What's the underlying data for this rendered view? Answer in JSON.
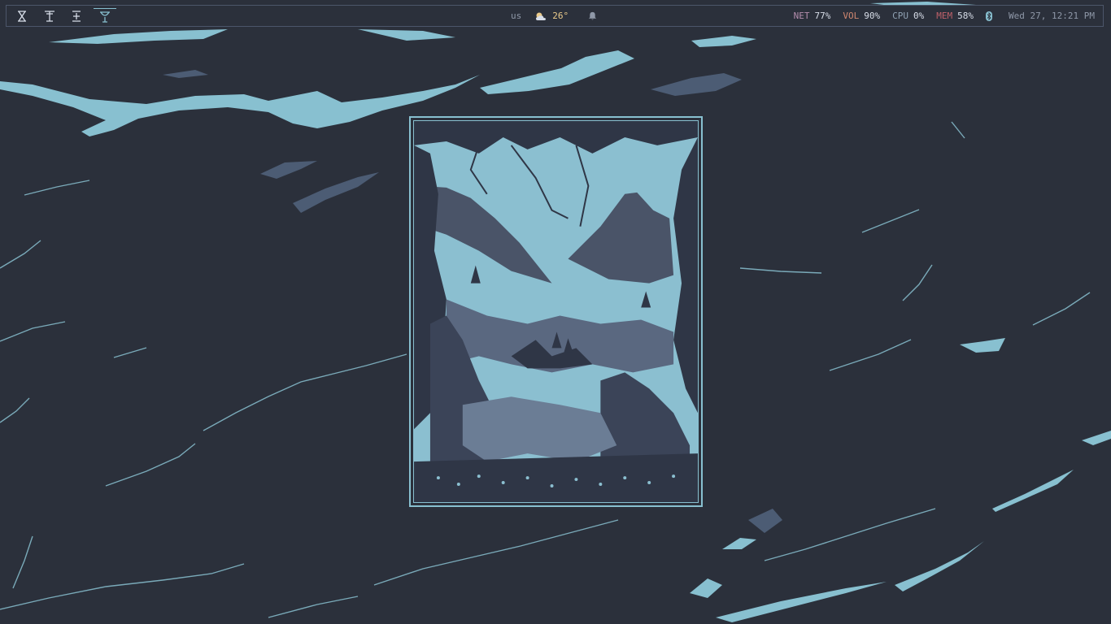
{
  "colors": {
    "background": "#2b303b",
    "accent": "#88c0d0",
    "bar_border": "#4c566a",
    "net": "#b48ead",
    "vol": "#d08770",
    "cpu": "#8fa1b3",
    "mem": "#bf616a",
    "temp": "#ebcb8b"
  },
  "bar": {
    "workspaces": [
      {
        "icon": "hourglass-icon",
        "active": false
      },
      {
        "icon": "martini-glass-icon",
        "active": false
      },
      {
        "icon": "plus-minus-icon",
        "active": false
      },
      {
        "icon": "cocktail-glass-icon",
        "active": true
      }
    ],
    "keyboard_layout": "us",
    "weather": {
      "icon": "partly-cloudy-icon",
      "temp": "26°"
    },
    "notification_icon": "bell-icon",
    "net": {
      "label": "NET",
      "value": "77%"
    },
    "vol": {
      "label": "VOL",
      "value": "90%"
    },
    "cpu": {
      "label": "CPU",
      "value": "0%"
    },
    "mem": {
      "label": "MEM",
      "value": "58%"
    },
    "bluetooth_icon": "bluetooth-icon",
    "clock": "Wed 27, 12:21 PM"
  },
  "wallpaper": {
    "description_icon": "marble-wallpaper",
    "artwork_icon": "mountain-valley-illustration"
  }
}
